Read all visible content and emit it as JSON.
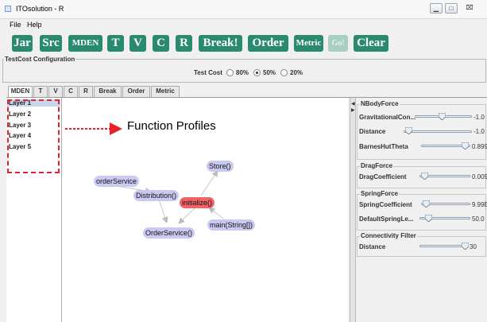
{
  "window": {
    "title": "ITOsolution - R"
  },
  "menu": {
    "file": "File",
    "help": "Help"
  },
  "toolbar": {
    "jar": "Jar",
    "src": "Src",
    "mden": "MDEN",
    "t": "T",
    "v": "V",
    "c": "C",
    "r": "R",
    "break": "Break!",
    "order": "Order",
    "metric": "Metric",
    "go": "Go!",
    "clear": "Clear",
    "button_color": "#2a8a70"
  },
  "testcost": {
    "title": "TestCost Configuration",
    "label": "Test Cost",
    "options": [
      "80%",
      "50%",
      "20%"
    ],
    "selected": "50%"
  },
  "tabs": [
    "MDEN",
    "T",
    "V",
    "C",
    "R",
    "Break",
    "Order",
    "Metric"
  ],
  "layers": [
    "Layer 1",
    "Layer 2",
    "Layer 3",
    "Layer 4",
    "Layer 5"
  ],
  "annotation": {
    "text": "Function Profiles",
    "color": "#e8202a"
  },
  "graph": {
    "nodes": {
      "orderService": "orderService",
      "distribution": "Distribution()",
      "initialize": "initialize()",
      "store": "Store()",
      "orderServiceCtor": "OrderService()",
      "main": "main(String[])"
    },
    "node_color": "#c9c9f2",
    "highlight_color": "#f06468"
  },
  "panel": {
    "nbody": {
      "title": "NBodyForce",
      "grav_label": "GravitationalCon...",
      "grav_value": "-1.0",
      "dist_label": "Distance",
      "dist_value": "-1.0",
      "barnes_label": "BarnesHutTheta",
      "barnes_value": "0.899"
    },
    "drag": {
      "title": "DragForce",
      "coef_label": "DragCoefficient",
      "coef_value": "0.009"
    },
    "spring": {
      "title": "SpringForce",
      "coef_label": "SpringCoefficient",
      "coef_value": "9.99E",
      "len_label": "DefaultSpringLe...",
      "len_value": "50.0"
    },
    "conn": {
      "title": "Connectivity Filter",
      "dist_label": "Distance",
      "dist_value": "30"
    }
  }
}
